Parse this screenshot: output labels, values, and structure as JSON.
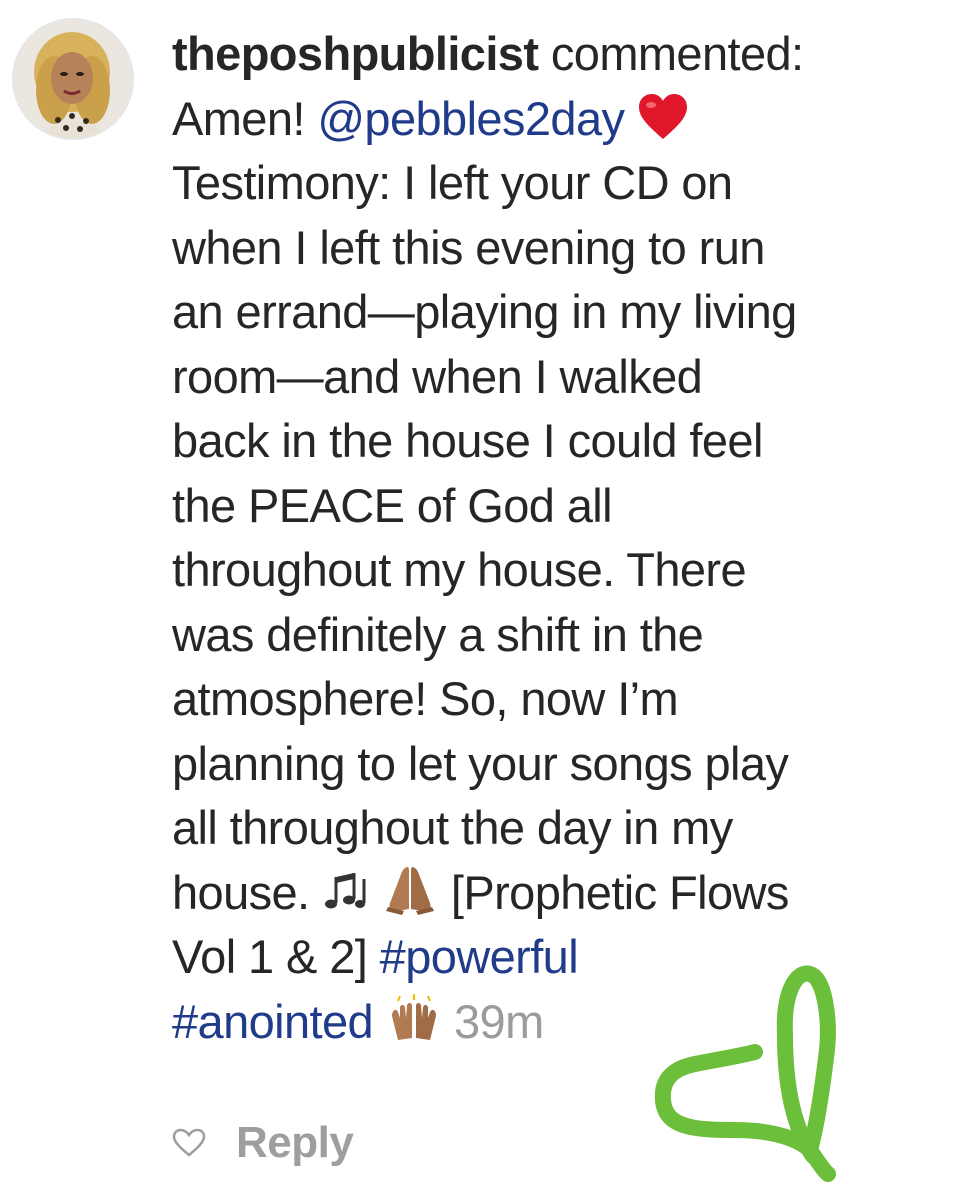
{
  "comment": {
    "username": "theposhpublicist",
    "action": "commented:",
    "amen": "Amen!",
    "mention": "@pebbles2day",
    "heart_emoji": "red-heart",
    "lines": [
      "Testimony: I left your CD on",
      "when I left this evening to run",
      "an errand—playing in my living",
      "room—and when I walked",
      "back in the house I could feel",
      "the PEACE of God all",
      "throughout my house. There",
      "was definitely a shift in the",
      "atmosphere! So, now I’m",
      "planning to let your songs play",
      "all throughout the day in my"
    ],
    "house_text": "house.",
    "music_emoji": "musical-notes",
    "pray_emoji": "folded-hands",
    "album_text": "[Prophetic Flows",
    "vol_text": "Vol 1 & 2]",
    "hashtag_powerful": "#powerful",
    "hashtag_anointed": "#anointed",
    "raised_hands_emoji": "raising-hands",
    "timestamp": "39m",
    "reply_label": "Reply",
    "like_icon": "heart-outline-icon"
  },
  "colors": {
    "text": "#262626",
    "link": "#1f3b8a",
    "muted": "#9b9b9b",
    "doodle": "#6bbf3a"
  }
}
